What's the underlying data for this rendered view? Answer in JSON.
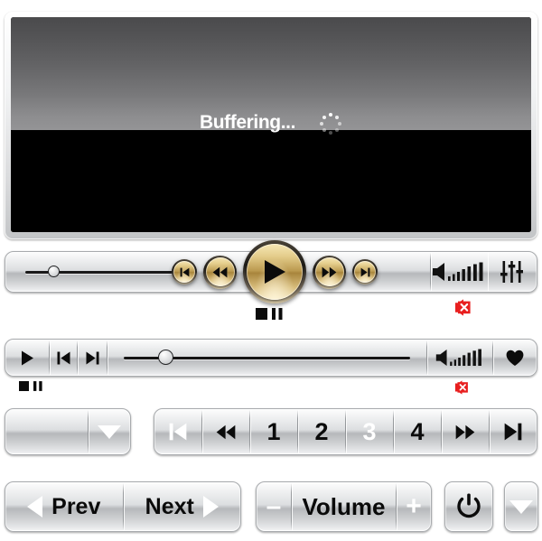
{
  "player": {
    "status_text": "Buffering...",
    "spinner_icon": "loading-spinner-icon",
    "screen_top_color": "#6a6a6c",
    "screen_bottom_color": "#000000"
  },
  "bar_main": {
    "seek": {
      "name": "seek-slider",
      "value_percent": 13
    },
    "transport": [
      {
        "id": "skip-start",
        "icon": "skip-to-start-icon",
        "size": "small"
      },
      {
        "id": "rewind",
        "icon": "rewind-icon",
        "size": "medium"
      },
      {
        "id": "play",
        "icon": "play-icon",
        "size": "large"
      },
      {
        "id": "fast-forward",
        "icon": "fast-forward-icon",
        "size": "medium"
      },
      {
        "id": "skip-end",
        "icon": "skip-to-end-icon",
        "size": "small"
      }
    ],
    "under_icons": [
      {
        "id": "stop",
        "icon": "stop-icon"
      },
      {
        "id": "pause",
        "icon": "pause-icon"
      }
    ],
    "volume": {
      "icon": "volume-bars-icon",
      "level_bars": 7,
      "muted_badge_icon": "volume-muted-icon"
    },
    "equalizer": {
      "icon": "equalizer-sliders-icon"
    },
    "accent_gold": "#c9a84f",
    "mute_badge_color": "#e81f1f"
  },
  "bar_secondary": {
    "buttons": [
      {
        "id": "play",
        "icon": "play-icon"
      },
      {
        "id": "previous",
        "icon": "skip-to-start-icon"
      },
      {
        "id": "next",
        "icon": "skip-to-end-icon"
      }
    ],
    "seek": {
      "name": "seek-slider-secondary",
      "value_percent": 12
    },
    "volume": {
      "icon": "volume-bars-icon",
      "level_bars": 7,
      "muted_badge_icon": "volume-muted-icon"
    },
    "favorite": {
      "icon": "heart-icon"
    },
    "under_icons": [
      {
        "id": "stop",
        "icon": "stop-icon"
      },
      {
        "id": "pause",
        "icon": "pause-icon"
      }
    ]
  },
  "combo": {
    "name": "dropdown-select",
    "value": "",
    "placeholder": "",
    "arrow_icon": "chevron-down-icon"
  },
  "pager": {
    "cells": [
      {
        "id": "first",
        "type": "icon",
        "icon": "skip-to-start-icon",
        "label": "",
        "active": true
      },
      {
        "id": "prev",
        "type": "icon",
        "icon": "rewind-icon",
        "label": "",
        "active": false
      },
      {
        "id": "page-1",
        "type": "number",
        "icon": "",
        "label": "1",
        "active": false
      },
      {
        "id": "page-2",
        "type": "number",
        "icon": "",
        "label": "2",
        "active": false
      },
      {
        "id": "page-3",
        "type": "number",
        "icon": "",
        "label": "3",
        "active": true
      },
      {
        "id": "page-4",
        "type": "number",
        "icon": "",
        "label": "4",
        "active": false
      },
      {
        "id": "next",
        "type": "icon",
        "icon": "fast-forward-icon",
        "label": "",
        "active": false
      },
      {
        "id": "last",
        "type": "icon",
        "icon": "skip-to-end-icon",
        "label": "",
        "active": false
      }
    ]
  },
  "prev_next": {
    "prev_label": "Prev",
    "next_label": "Next",
    "prev_icon": "triangle-left-icon",
    "next_icon": "triangle-right-icon"
  },
  "volume_bar": {
    "minus_label": "–",
    "label": "Volume",
    "plus_label": "+"
  },
  "power": {
    "name": "power-button",
    "icon": "power-icon"
  },
  "dropdown_button": {
    "name": "dropdown-button",
    "icon": "triangle-down-icon"
  }
}
